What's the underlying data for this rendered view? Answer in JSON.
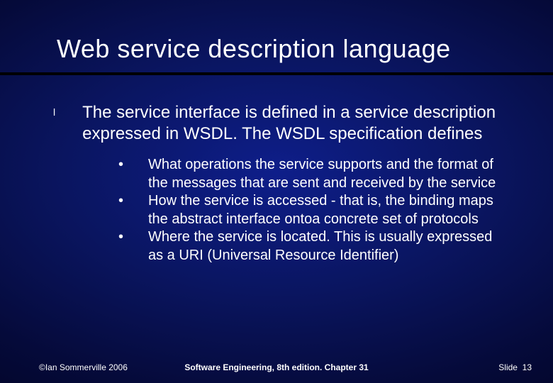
{
  "slide": {
    "title": "Web service description language",
    "main_bullet": "l",
    "main_text": "The service interface is defined in a service description expressed in WSDL. The WSDL specification defines",
    "sub_bullet": "•",
    "sub_items": [
      "What operations the service supports and the format of the messages that are sent and received by the service",
      "How the service is accessed - that is, the binding maps the abstract interface ontoa concrete set of protocols",
      "Where the service is located. This is usually expressed as a URI (Universal Resource Identifier)"
    ],
    "footer": {
      "left": "©Ian Sommerville 2006",
      "center": "Software Engineering, 8th edition. Chapter 31",
      "right_label": "Slide",
      "right_number": "13"
    }
  }
}
